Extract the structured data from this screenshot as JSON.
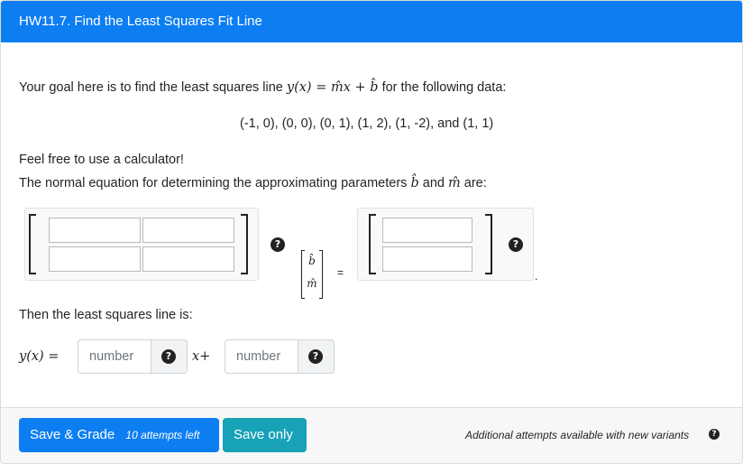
{
  "header": {
    "title": "HW11.7. Find the Least Squares Fit Line"
  },
  "question": {
    "intro_before": "Your goal here is to find the least squares line",
    "equation": "y(x) = m̂x + b̂",
    "intro_after": "for the following data:",
    "data_points": "(-1, 0), (0, 0), (0, 1), (1, 2), (1, -2), and (1, 1)",
    "calculator_note": "Feel free to use a calculator!",
    "normal_eq_before": "The normal equation for determining the approximating parameters",
    "param_b": "b̂",
    "param_and": "and",
    "param_m": "m̂",
    "normal_eq_after": "are:",
    "vector_b": "b̂",
    "vector_m": "m̂",
    "equals": "=",
    "period": ".",
    "then_text": "Then the least squares line is:",
    "line_lhs": "y(x) =",
    "line_mid": "x+"
  },
  "inputs": {
    "slope_placeholder": "number",
    "intercept_placeholder": "number",
    "help_glyph": "?"
  },
  "footer": {
    "save_grade_label": "Save & Grade",
    "attempts_left": "10 attempts left",
    "save_only_label": "Save only",
    "additional_attempts": "Additional attempts available with new variants"
  },
  "colors": {
    "primary": "#0d7ef2",
    "info": "#17a2b8",
    "header_text": "#ffffff"
  }
}
